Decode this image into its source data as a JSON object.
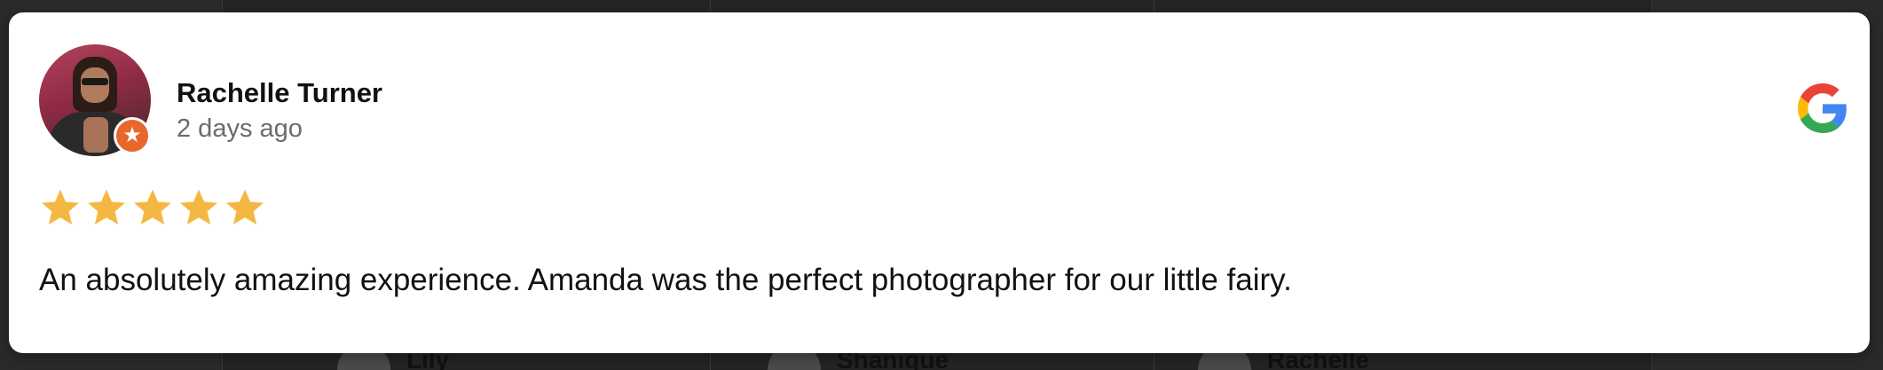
{
  "review": {
    "reviewer_name": "Rachelle Turner",
    "time_ago": "2 days ago",
    "rating": 5,
    "rating_max": 5,
    "text": "An absolutely amazing experience. Amanda was the perfect photographer for our little fairy."
  },
  "icons": {
    "source": "google-icon",
    "badge": "local-guide-star-icon",
    "rating": "star-icon"
  },
  "colors": {
    "star": "#F4B842",
    "badge": "#E8672A",
    "google_blue": "#4285F4",
    "google_red": "#EA4335",
    "google_yellow": "#FBBC05",
    "google_green": "#34A853",
    "card_bg": "#FFFFFF",
    "page_bg": "#2A2A2A"
  },
  "background": {
    "peek_names": [
      "Lily",
      "Shanique",
      "Rachelle"
    ]
  }
}
